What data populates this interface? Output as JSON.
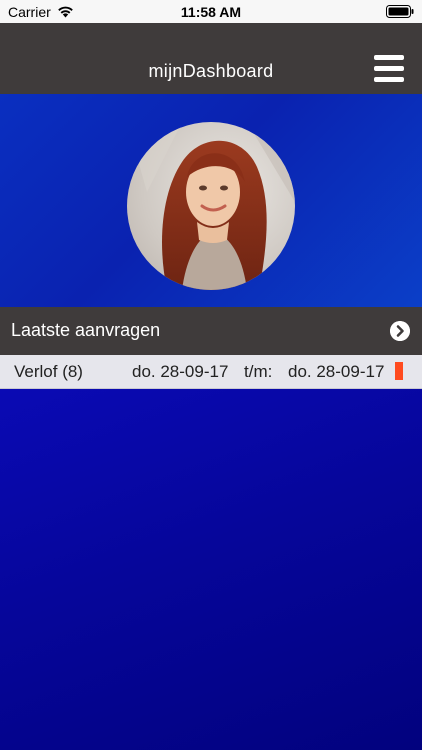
{
  "status_bar": {
    "carrier": "Carrier",
    "time": "11:58 AM"
  },
  "nav": {
    "title": "mijnDashboard",
    "menu_icon": "hamburger-menu-icon"
  },
  "profile": {
    "avatar_icon": "profile-photo"
  },
  "latest_requests": {
    "title": "Laatste aanvragen",
    "chevron_icon": "chevron-right-icon",
    "items": [
      {
        "type": "Verlof (8)",
        "start": "do. 28-09-17",
        "separator": "t/m:",
        "end": "do. 28-09-17",
        "status_color": "#ff4b1f"
      }
    ]
  },
  "colors": {
    "nav_background": "#3f3b3b",
    "content_background": "#0a0a9c",
    "row_background": "#e6e6ec"
  }
}
